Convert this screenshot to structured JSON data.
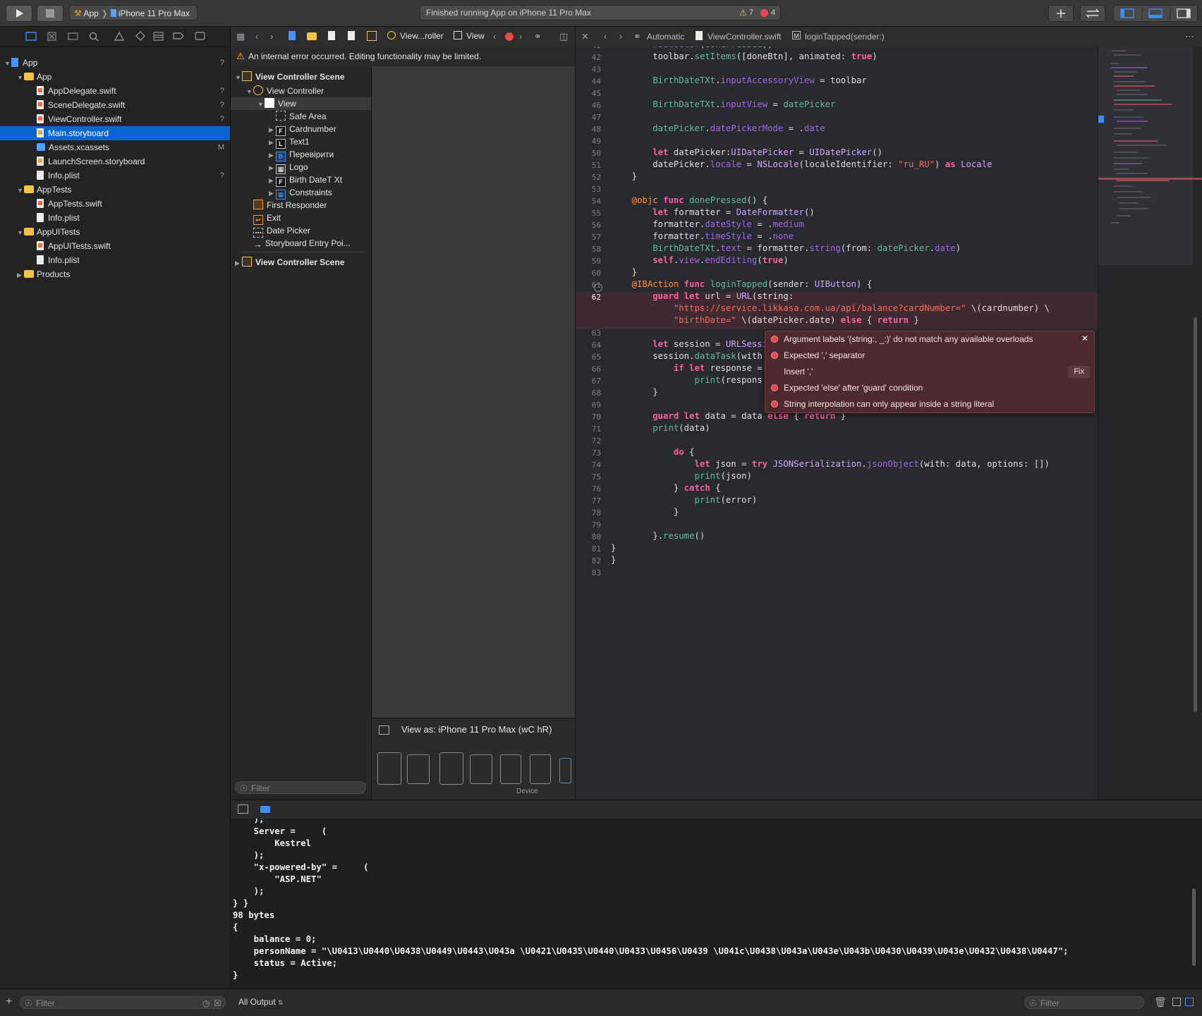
{
  "toolbar": {
    "scheme": "App",
    "device": "iPhone 11 Pro Max",
    "status": "Finished running App on iPhone 11 Pro Max",
    "warnings": "7",
    "errors": "4"
  },
  "navigator": {
    "items": [
      {
        "label": "App",
        "badge": "?",
        "kind": "project",
        "indent": 0,
        "expanded": true
      },
      {
        "label": "App",
        "badge": "",
        "kind": "folder",
        "indent": 1,
        "expanded": true
      },
      {
        "label": "AppDelegate.swift",
        "badge": "?",
        "kind": "swift",
        "indent": 2
      },
      {
        "label": "SceneDelegate.swift",
        "badge": "?",
        "kind": "swift",
        "indent": 2
      },
      {
        "label": "ViewController.swift",
        "badge": "?",
        "kind": "swift",
        "indent": 2
      },
      {
        "label": "Main.storyboard",
        "badge": "",
        "kind": "storyboard",
        "indent": 2,
        "selected": true
      },
      {
        "label": "Assets.xcassets",
        "badge": "M",
        "kind": "assets",
        "indent": 2
      },
      {
        "label": "LaunchScreen.storyboard",
        "badge": "",
        "kind": "storyboard",
        "indent": 2
      },
      {
        "label": "Info.plist",
        "badge": "?",
        "kind": "plist",
        "indent": 2
      },
      {
        "label": "AppTests",
        "badge": "",
        "kind": "folder",
        "indent": 1,
        "expanded": true
      },
      {
        "label": "AppTests.swift",
        "badge": "",
        "kind": "swift",
        "indent": 2
      },
      {
        "label": "Info.plist",
        "badge": "",
        "kind": "plist",
        "indent": 2
      },
      {
        "label": "AppUITests",
        "badge": "",
        "kind": "folder",
        "indent": 1,
        "expanded": true
      },
      {
        "label": "AppUITests.swift",
        "badge": "",
        "kind": "swift",
        "indent": 2
      },
      {
        "label": "Info.plist",
        "badge": "",
        "kind": "plist",
        "indent": 2
      },
      {
        "label": "Products",
        "badge": "",
        "kind": "folder",
        "indent": 1,
        "expanded": false
      }
    ],
    "filter_placeholder": "Filter"
  },
  "ib": {
    "breadcrumb_controller": "View...roller",
    "breadcrumb_view": "View",
    "warning": "An internal error occurred. Editing functionality may be limited.",
    "outline": [
      {
        "label": "View Controller Scene",
        "icon": "scene",
        "indent": 0,
        "arrow": "down",
        "bold": true
      },
      {
        "label": "View Controller",
        "icon": "vc",
        "indent": 1,
        "arrow": "down"
      },
      {
        "label": "View",
        "icon": "view",
        "indent": 2,
        "arrow": "down",
        "selected": true
      },
      {
        "label": "Safe Area",
        "icon": "safe",
        "indent": 3,
        "arrow": ""
      },
      {
        "label": "Cardnumber",
        "icon": "F",
        "indent": 3,
        "arrow": "right"
      },
      {
        "label": "Text1",
        "icon": "L",
        "indent": 3,
        "arrow": "right"
      },
      {
        "label": "Перевірити",
        "icon": "B",
        "indent": 3,
        "arrow": "right"
      },
      {
        "label": "Logo",
        "icon": "img",
        "indent": 3,
        "arrow": "right"
      },
      {
        "label": "Birth DateT Xt",
        "icon": "F",
        "indent": 3,
        "arrow": "right"
      },
      {
        "label": "Constraints",
        "icon": "cons",
        "indent": 3,
        "arrow": "right"
      },
      {
        "label": "First Responder",
        "icon": "fr",
        "indent": 1,
        "arrow": ""
      },
      {
        "label": "Exit",
        "icon": "exit",
        "indent": 1,
        "arrow": ""
      },
      {
        "label": "Date Picker",
        "icon": "dp",
        "indent": 1,
        "arrow": ""
      },
      {
        "label": "Storyboard Entry Poi...",
        "icon": "arrow",
        "indent": 1,
        "arrow": ""
      },
      {
        "label": "View Controller Scene",
        "icon": "scene",
        "indent": 0,
        "arrow": "right",
        "bold": true
      }
    ],
    "view_as": "View as: iPhone 11 Pro Max (",
    "view_as_traits": "wC hR)",
    "device_label": "Device",
    "filter_placeholder": "Filter"
  },
  "editor": {
    "jump_mode": "Automatic",
    "jump_file": "ViewController.swift",
    "jump_symbol": "loginTapped(sender:)"
  },
  "errors": [
    {
      "text": "Argument labels '(string:, _:)' do not match any available overloads",
      "kind": "error"
    },
    {
      "text": "Expected ',' separator",
      "kind": "error"
    },
    {
      "text": "Insert ','",
      "kind": "fix",
      "fix_label": "Fix"
    },
    {
      "text": "Expected 'else' after 'guard' condition",
      "kind": "error"
    },
    {
      "text": "String interpolation can only appear inside a string literal",
      "kind": "error"
    }
  ],
  "console": {
    "lines": [
      "    );",
      "    Server =     (",
      "        Kestrel",
      "    );",
      "    \"x-powered-by\" =     (",
      "        \"ASP.NET\"",
      "    );",
      "} }",
      "98 bytes",
      "{",
      "    balance = 0;",
      "    personName = \"\\U0413\\U0440\\U0438\\U0449\\U0443\\U043a \\U0421\\U0435\\U0440\\U0433\\U0456\\U0439 \\U041c\\U0438\\U043a\\U043e\\U043b\\U0430\\U0439\\U043e\\U0432\\U0438\\U0447\";",
      "    status = Active;",
      "}"
    ],
    "output_selector": "All Output",
    "filter_placeholder": "Filter"
  },
  "colors": {
    "selection": "#0a64d6",
    "error": "#e5484d",
    "keyword": "#fc5fa3",
    "string": "#fc6a5d"
  }
}
